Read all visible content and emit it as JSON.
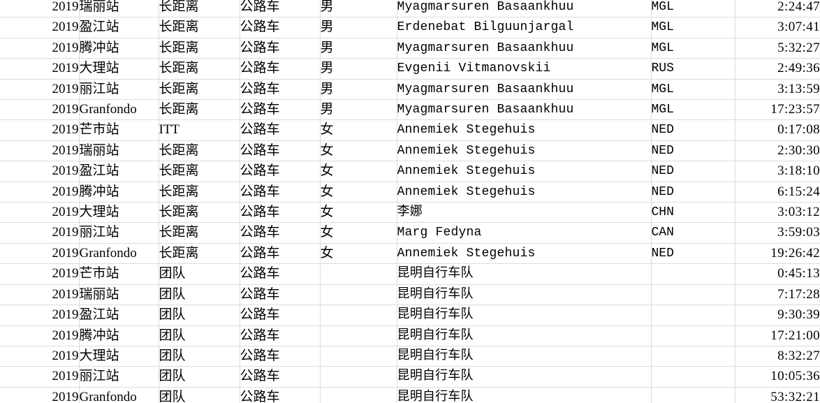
{
  "table": {
    "columns": [
      {
        "key": "year",
        "name": "year-column"
      },
      {
        "key": "stage",
        "name": "stage-column"
      },
      {
        "key": "event_type",
        "name": "event-type-column"
      },
      {
        "key": "discipline",
        "name": "discipline-column"
      },
      {
        "key": "gender",
        "name": "gender-column"
      },
      {
        "key": "name",
        "name": "name-column"
      },
      {
        "key": "nation",
        "name": "nation-column"
      },
      {
        "key": "time",
        "name": "time-column"
      }
    ],
    "rows": [
      {
        "year": "2019",
        "stage": "瑞丽站",
        "event_type": "长距离",
        "discipline": "公路车",
        "gender": "男",
        "name": "Myagmarsuren Basaankhuu",
        "nation": "MGL",
        "time": "2:24:47"
      },
      {
        "year": "2019",
        "stage": "盈江站",
        "event_type": "长距离",
        "discipline": "公路车",
        "gender": "男",
        "name": "Erdenebat Bilguunjargal",
        "nation": "MGL",
        "time": "3:07:41"
      },
      {
        "year": "2019",
        "stage": "腾冲站",
        "event_type": "长距离",
        "discipline": "公路车",
        "gender": "男",
        "name": "Myagmarsuren Basaankhuu",
        "nation": "MGL",
        "time": "5:32:27"
      },
      {
        "year": "2019",
        "stage": "大理站",
        "event_type": "长距离",
        "discipline": "公路车",
        "gender": "男",
        "name": "Evgenii Vitmanovskii",
        "nation": "RUS",
        "time": "2:49:36"
      },
      {
        "year": "2019",
        "stage": "丽江站",
        "event_type": "长距离",
        "discipline": "公路车",
        "gender": "男",
        "name": "Myagmarsuren Basaankhuu",
        "nation": "MGL",
        "time": "3:13:59"
      },
      {
        "year": "2019",
        "stage": "Granfondo",
        "event_type": "长距离",
        "discipline": "公路车",
        "gender": "男",
        "name": "Myagmarsuren Basaankhuu",
        "nation": "MGL",
        "time": "17:23:57"
      },
      {
        "year": "2019",
        "stage": "芒市站",
        "event_type": "ITT",
        "discipline": "公路车",
        "gender": "女",
        "name": "Annemiek Stegehuis",
        "nation": "NED",
        "time": "0:17:08"
      },
      {
        "year": "2019",
        "stage": "瑞丽站",
        "event_type": "长距离",
        "discipline": "公路车",
        "gender": "女",
        "name": "Annemiek Stegehuis",
        "nation": "NED",
        "time": "2:30:30"
      },
      {
        "year": "2019",
        "stage": "盈江站",
        "event_type": "长距离",
        "discipline": "公路车",
        "gender": "女",
        "name": "Annemiek Stegehuis",
        "nation": "NED",
        "time": "3:18:10"
      },
      {
        "year": "2019",
        "stage": "腾冲站",
        "event_type": "长距离",
        "discipline": "公路车",
        "gender": "女",
        "name": "Annemiek Stegehuis",
        "nation": "NED",
        "time": "6:15:24"
      },
      {
        "year": "2019",
        "stage": "大理站",
        "event_type": "长距离",
        "discipline": "公路车",
        "gender": "女",
        "name": "李娜",
        "nation": "CHN",
        "time": "3:03:12"
      },
      {
        "year": "2019",
        "stage": "丽江站",
        "event_type": "长距离",
        "discipline": "公路车",
        "gender": "女",
        "name": "Marg Fedyna",
        "nation": "CAN",
        "time": "3:59:03"
      },
      {
        "year": "2019",
        "stage": "Granfondo",
        "event_type": "长距离",
        "discipline": "公路车",
        "gender": "女",
        "name": "Annemiek Stegehuis",
        "nation": "NED",
        "time": "19:26:42"
      },
      {
        "year": "2019",
        "stage": "芒市站",
        "event_type": "团队",
        "discipline": "公路车",
        "gender": "",
        "name": "昆明自行车队",
        "nation": "",
        "time": "0:45:13"
      },
      {
        "year": "2019",
        "stage": "瑞丽站",
        "event_type": "团队",
        "discipline": "公路车",
        "gender": "",
        "name": "昆明自行车队",
        "nation": "",
        "time": "7:17:28"
      },
      {
        "year": "2019",
        "stage": "盈江站",
        "event_type": "团队",
        "discipline": "公路车",
        "gender": "",
        "name": "昆明自行车队",
        "nation": "",
        "time": "9:30:39"
      },
      {
        "year": "2019",
        "stage": "腾冲站",
        "event_type": "团队",
        "discipline": "公路车",
        "gender": "",
        "name": "昆明自行车队",
        "nation": "",
        "time": "17:21:00"
      },
      {
        "year": "2019",
        "stage": "大理站",
        "event_type": "团队",
        "discipline": "公路车",
        "gender": "",
        "name": "昆明自行车队",
        "nation": "",
        "time": "8:32:27"
      },
      {
        "year": "2019",
        "stage": "丽江站",
        "event_type": "团队",
        "discipline": "公路车",
        "gender": "",
        "name": "昆明自行车队",
        "nation": "",
        "time": "10:05:36"
      },
      {
        "year": "2019",
        "stage": "Granfondo",
        "event_type": "团队",
        "discipline": "公路车",
        "gender": "",
        "name": "昆明自行车队",
        "nation": "",
        "time": "53:32:21"
      }
    ]
  },
  "style": {
    "grid_line_color": "#dcdcdc",
    "text_color": "#000000",
    "background_color": "#ffffff"
  }
}
